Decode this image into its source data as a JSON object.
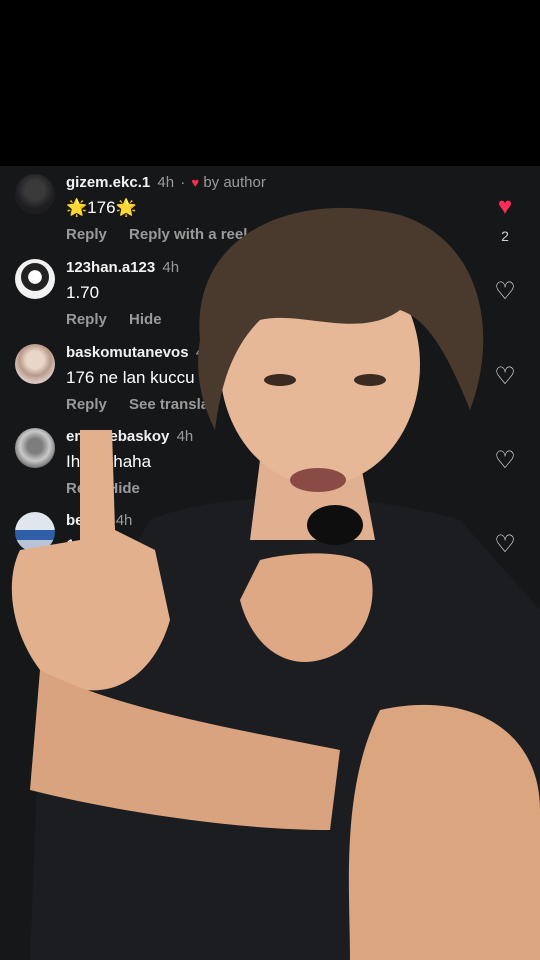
{
  "comments": [
    {
      "user": "gizem.ekc.1",
      "time": "4h",
      "by_author": "by author",
      "text_star_left": "🌟",
      "text": "176",
      "text_star_right": "🌟",
      "actions": [
        "Reply",
        "Reply with a reel"
      ],
      "liked": true,
      "like_count": "2"
    },
    {
      "user": "123han.a123",
      "time": "4h",
      "text": "1.70",
      "actions": [
        "Reply",
        "Hide"
      ],
      "liked": false
    },
    {
      "user": "baskomutanevos",
      "time": "4",
      "text": "176 ne lan kuccu",
      "actions": [
        "Reply",
        "See transla"
      ],
      "liked": false
    },
    {
      "user": "em  egebaskoy",
      "time": "4h",
      "text": "Iha  ahhaha",
      "actions": [
        "Re",
        "Hide"
      ],
      "liked": false
    },
    {
      "user": "be   i02",
      "time": "4h",
      "text": "1   etre",
      "actions": [],
      "liked": false
    }
  ],
  "colors": {
    "background": "#161719",
    "accent_like": "#ff2d55",
    "muted": "#9a9a9a"
  },
  "icons": {
    "like": "heart-outline-icon",
    "liked": "heart-filled-icon"
  }
}
